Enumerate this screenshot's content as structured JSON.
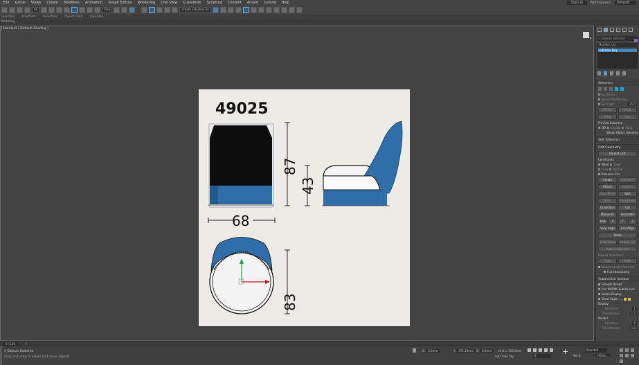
{
  "menu": {
    "items": [
      "Edit",
      "Group",
      "Views",
      "Create",
      "Modifiers",
      "Animation",
      "Graph Editors",
      "Rendering",
      "Civil View",
      "Customize",
      "Scripting",
      "Content",
      "Arnold",
      "Corona",
      "Help"
    ],
    "signin": "Sign In",
    "workspaces_label": "Workspaces:",
    "workspaces_value": "Default"
  },
  "toolbar": {
    "filter_value": "All",
    "view_value": "View",
    "selection_set": "Create Selection Se"
  },
  "ribbon": {
    "tabs": [
      "Selection",
      "Freeform",
      "Selection",
      "Object Paint",
      "Populate"
    ],
    "subtitle": "Modeling"
  },
  "viewport": {
    "label": "[Standard ] [Default Shading ]"
  },
  "drawing": {
    "model_number": "49025",
    "dim_height": "87",
    "dim_seat_height": "43",
    "dim_width": "68",
    "dim_depth": "83"
  },
  "command_panel": {
    "object_name": "2 Objects Selected",
    "modifier_list": "Modifier List",
    "stack_item": "Editable Poly",
    "selection_title": "Selection",
    "by_vertex": "By Vertex",
    "ignore_backfacing": "Ignore Backfacing",
    "by_angle": "By Angle:",
    "by_angle_value": "45.0",
    "shrink": "Shrink",
    "grow": "Grow",
    "ring": "Ring",
    "loop": "Loop",
    "preview_selection": "Preview Selection",
    "off": "Off",
    "subobj": "SubObj",
    "multi": "Multi",
    "whole_object_selected": "Whole Object Selected",
    "soft_selection_title": "Soft Selection",
    "edit_geometry_title": "Edit Geometry",
    "repeat_last": "Repeat Last",
    "constraints": "Constraints",
    "none": "None",
    "edge": "Edge",
    "face": "Face",
    "normal": "Normal",
    "preserve_uvs": "Preserve UVs",
    "create": "Create",
    "collapse": "Collapse",
    "attach": "Attach",
    "detach": "Detach",
    "slice_plane": "Slice Plane",
    "split": "Split",
    "slice": "Slice",
    "reset_plane": "Reset Plane",
    "quickslice": "QuickSlice",
    "cut": "Cut",
    "msmooth": "MSmooth",
    "tessellate": "Tessellate",
    "make_planar": "Make Planar",
    "x": "X",
    "y": "Y",
    "z": "Z",
    "view_align": "View Align",
    "grid_align": "Grid Align",
    "relax": "Relax",
    "hide_selected": "Hide Selected",
    "unhide_all": "Unhide All",
    "hide_unselected": "Hide Unselected",
    "named_selections": "Named Selections:",
    "copy": "Copy",
    "paste": "Paste",
    "delete_isolated": "Delete Isolated Vertices",
    "full_interactivity": "Full Interactivity",
    "subdivision_title": "Subdivision Surface",
    "smooth_result": "Smooth Result",
    "use_nurms": "Use NURMS Subdivision",
    "isoline_display": "Isoline Display",
    "show_cage": "Show Cage......",
    "display": "Display",
    "iterations": "Iterations:",
    "iterations_value": "1",
    "smoothness": "Smoothness:",
    "smoothness_value": "1.0",
    "render": "Render",
    "render_iterations": "Iterations:",
    "render_iterations_value": "0",
    "render_smoothness": "Smoothness:",
    "render_smoothness_value": "1.0"
  },
  "timeline": {
    "frame_label": "0 / 100",
    "arrow": ">"
  },
  "status": {
    "line1": "2 Objects Selected",
    "line2": "Click and drag to select and move objects",
    "x_label": "X:",
    "x_value": "0.0mm",
    "y_label": "Y:",
    "y_value": "371.29mm",
    "z_label": "Z:",
    "z_value": "0.0mm",
    "grid": "Grid = 100.0mm",
    "add_time_tag": "Add Time Tag",
    "selected": "Selected",
    "setk": "Set K.",
    "filters": "Filters...",
    "frame_value": "0"
  },
  "colors": {
    "background": "#3b3b3b",
    "panel": "#444444",
    "accent": "#4a86b8",
    "chair_blue": "#2f6ea8"
  }
}
